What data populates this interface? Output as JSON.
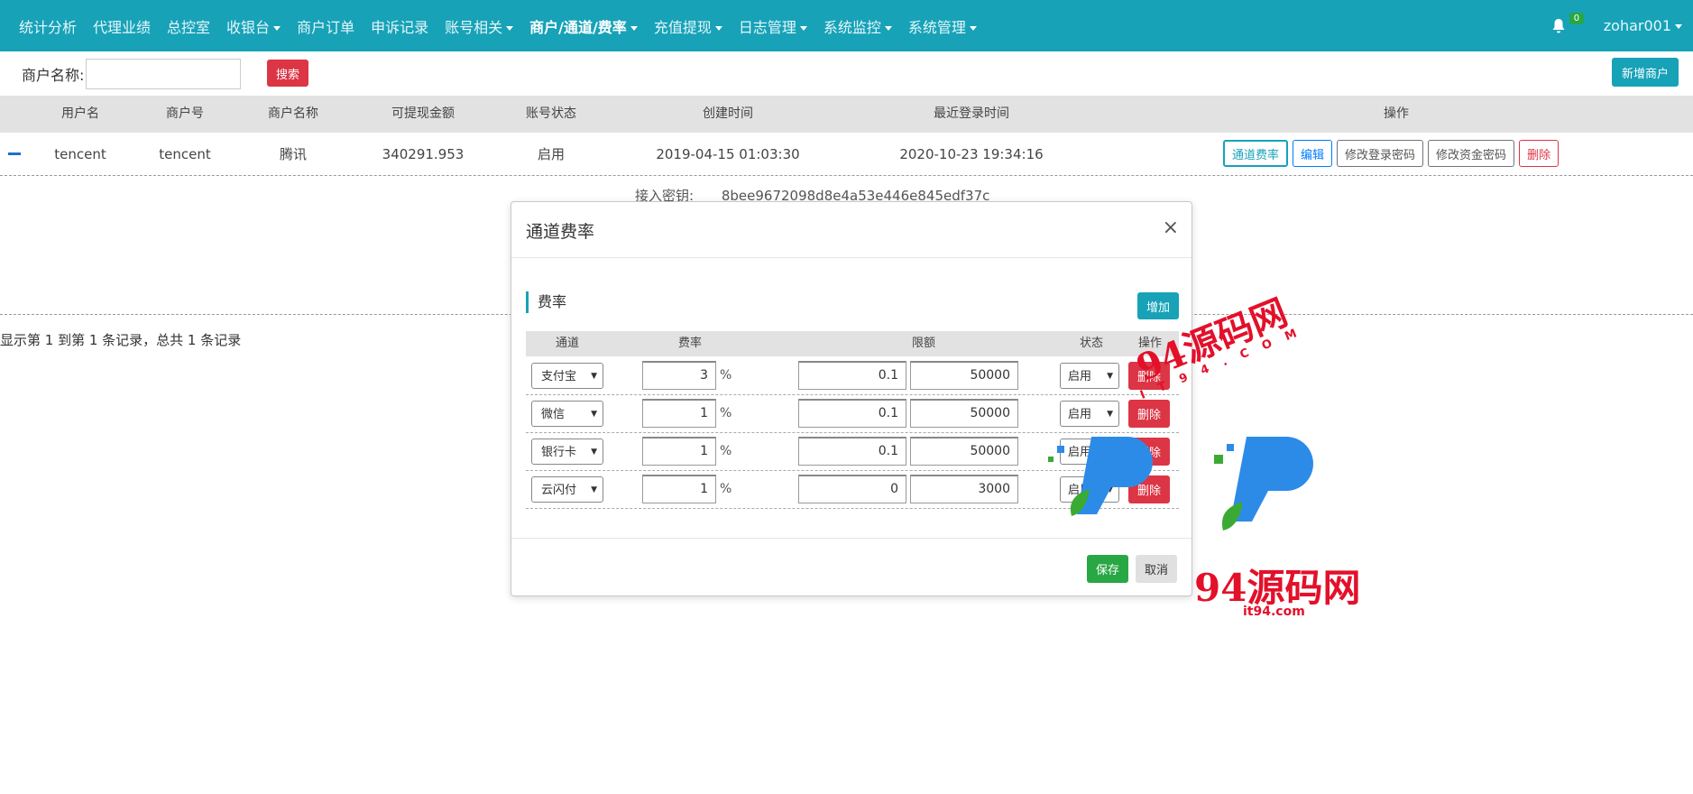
{
  "navbar": {
    "items": [
      {
        "label": "统计分析",
        "dropdown": false
      },
      {
        "label": "代理业绩",
        "dropdown": false
      },
      {
        "label": "总控室",
        "dropdown": false
      },
      {
        "label": "收银台",
        "dropdown": true
      },
      {
        "label": "商户订单",
        "dropdown": false
      },
      {
        "label": "申诉记录",
        "dropdown": false
      },
      {
        "label": "账号相关",
        "dropdown": true
      },
      {
        "label": "商户/通道/费率",
        "dropdown": true,
        "active": true
      },
      {
        "label": "充值提现",
        "dropdown": true
      },
      {
        "label": "日志管理",
        "dropdown": true
      },
      {
        "label": "系统监控",
        "dropdown": true
      },
      {
        "label": "系统管理",
        "dropdown": true
      }
    ],
    "notification_count": "0",
    "user": "zohar001"
  },
  "search": {
    "label": "商户名称:",
    "value": "",
    "button": "搜索"
  },
  "add_merchant_button": "新增商户",
  "table": {
    "headers": [
      "用户名",
      "商户号",
      "商户名称",
      "可提现金额",
      "账号状态",
      "创建时间",
      "最近登录时间",
      "操作"
    ],
    "row": {
      "username": "tencent",
      "merchant_no": "tencent",
      "merchant_name": "腾讯",
      "withdrawable": "340291.953",
      "status": "启用",
      "created": "2019-04-15 01:03:30",
      "last_login": "2020-10-23 19:34:16",
      "actions": [
        "通道费率",
        "编辑",
        "修改登录密码",
        "修改资金密码",
        "删除"
      ]
    },
    "detail": {
      "label": "接入密钥:",
      "value": "8bee9672098d8e4a53e446e845edf37c"
    }
  },
  "pagination_info": "显示第 1 到第 1 条记录，总共 1 条记录",
  "modal": {
    "title": "通道费率",
    "close": "×",
    "section_title": "费率",
    "add_button": "增加",
    "headers": [
      "通道",
      "费率",
      "限额",
      "状态",
      "操作"
    ],
    "percent_sign": "%",
    "rows": [
      {
        "channel": "支付宝",
        "rate": "3",
        "min": "0.1",
        "max": "50000",
        "status": "启用",
        "delete": "删除"
      },
      {
        "channel": "微信",
        "rate": "1",
        "min": "0.1",
        "max": "50000",
        "status": "启用",
        "delete": "删除"
      },
      {
        "channel": "银行卡",
        "rate": "1",
        "min": "0.1",
        "max": "50000",
        "status": "启用",
        "delete": "删除"
      },
      {
        "channel": "云闪付",
        "rate": "1",
        "min": "0",
        "max": "3000",
        "status": "启用",
        "delete": "删除"
      }
    ],
    "save": "保存",
    "cancel": "取消"
  },
  "watermark": {
    "text_top": "94源码网",
    "text_mid": "I T 9 4 . C O M",
    "text_big": "94源码网",
    "url": "it94.com"
  },
  "colors": {
    "navbar": "#17a2b8",
    "danger": "#dc3545",
    "success": "#28a745",
    "watermark": "#e3102a"
  }
}
